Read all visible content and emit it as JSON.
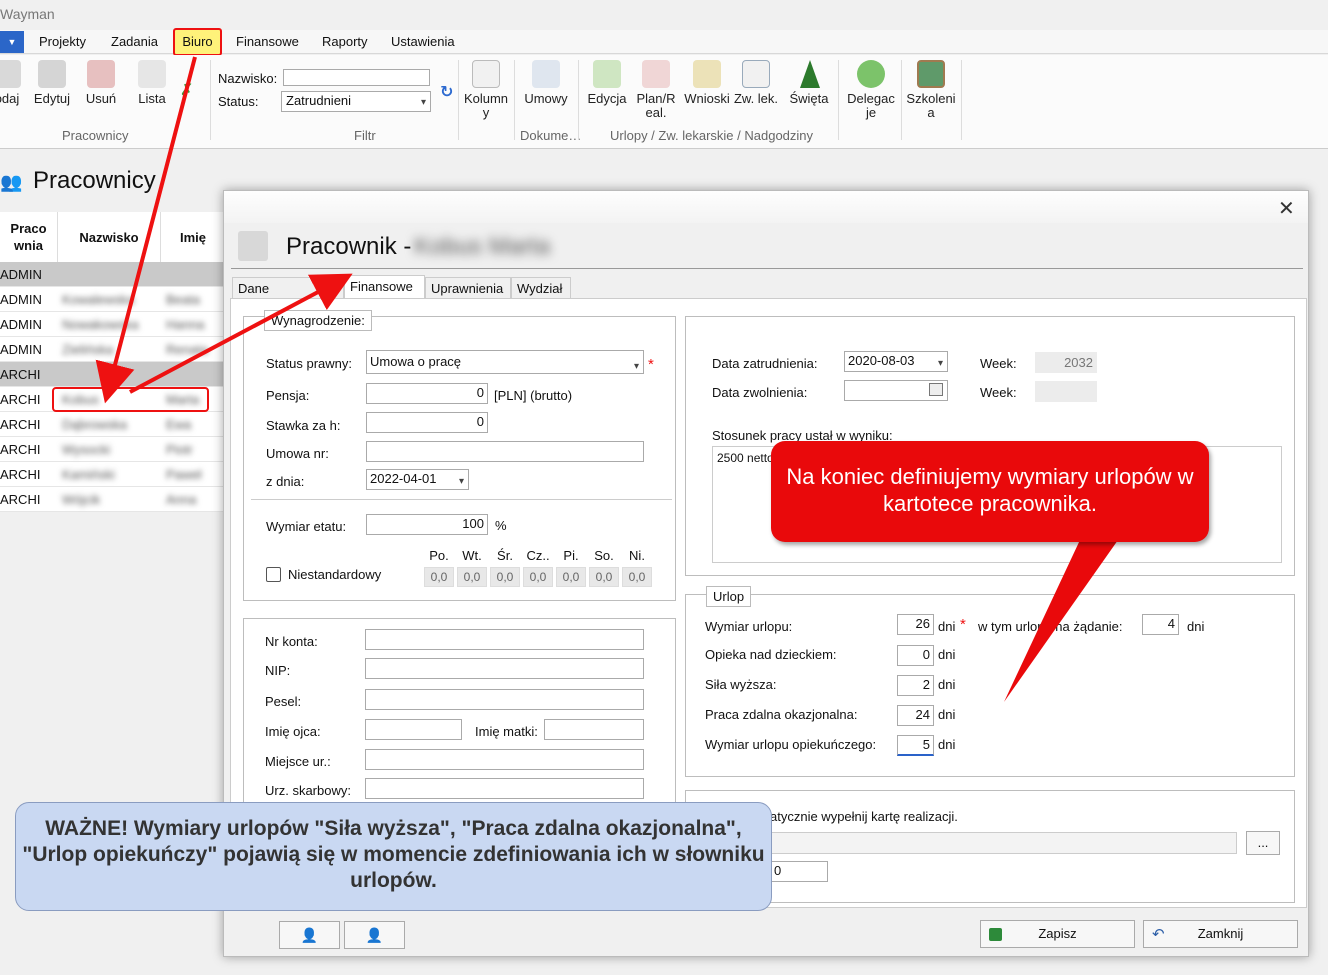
{
  "app": {
    "title": "Wayman"
  },
  "menu": {
    "dropdown_glyph": "▼",
    "items": [
      "Projekty",
      "Zadania",
      "Biuro",
      "Finansowe",
      "Raporty",
      "Ustawienia"
    ]
  },
  "ribbon": {
    "pracownicy_buttons": [
      "odaj",
      "Edytuj",
      "Usuń",
      "Lista"
    ],
    "pracownicy_label": "Pracownicy",
    "filtr": {
      "nazwisko_label": "Nazwisko:",
      "nazwisko_value": "",
      "status_label": "Status:",
      "status_value": "Zatrudnieni",
      "label": "Filtr"
    },
    "kolumny": [
      "Kolumn",
      "y"
    ],
    "umowy": "Umowy",
    "dokumenty_label": "Dokume…",
    "urlopy_buttons": [
      [
        "Edycja",
        ""
      ],
      [
        "Plan/R",
        "eal."
      ],
      [
        "Wnioski",
        ""
      ],
      [
        "Zw. lek.",
        ""
      ],
      [
        "Święta",
        ""
      ]
    ],
    "urlopy_label": "Urlopy / Zw. lekarskie / Nadgodziny",
    "delegacje": [
      "Delegac",
      "je"
    ],
    "szkolenia": [
      "Szkoleni",
      "a"
    ]
  },
  "list": {
    "title": "Pracownicy",
    "headers": [
      "Praco\nwnia",
      "Nazwisko",
      "Imię"
    ],
    "rows": [
      {
        "pracownia": "ADMIN",
        "nazwisko": "",
        "imie": "",
        "gray": true
      },
      {
        "pracownia": "ADMIN",
        "nazwisko": "Kowalewska",
        "imie": "Beata",
        "gray": false
      },
      {
        "pracownia": "ADMIN",
        "nazwisko": "Nowakowska",
        "imie": "Hanna",
        "gray": false
      },
      {
        "pracownia": "ADMIN",
        "nazwisko": "Zielińska",
        "imie": "Renata",
        "gray": false
      },
      {
        "pracownia": "ARCHI",
        "nazwisko": "",
        "imie": "",
        "gray": true
      },
      {
        "pracownia": "ARCHI",
        "nazwisko": "Kobus",
        "imie": "Marta",
        "gray": false
      },
      {
        "pracownia": "ARCHI",
        "nazwisko": "Dąbrowska",
        "imie": "Ewa",
        "gray": false
      },
      {
        "pracownia": "ARCHI",
        "nazwisko": "Wysocki",
        "imie": "Piotr",
        "gray": false
      },
      {
        "pracownia": "ARCHI",
        "nazwisko": "Kamiński",
        "imie": "Paweł",
        "gray": false
      },
      {
        "pracownia": "ARCHI",
        "nazwisko": "Wójcik",
        "imie": "Anna",
        "gray": false
      }
    ]
  },
  "dialog": {
    "title": "Pracownik -",
    "employee_name": "Kobus Marta",
    "close_glyph": "✕",
    "tabs": [
      "Dane pracownika",
      "Finansowe",
      "Uprawnienia",
      "Wydział"
    ],
    "wynagrodzenie": {
      "label": "Wynagrodzenie:",
      "status_prawny_label": "Status prawny:",
      "status_prawny_value": "Umowa o pracę",
      "pensja_label": "Pensja:",
      "pensja_value": "0",
      "pensja_unit": "[PLN] (brutto)",
      "stawka_label": "Stawka za h:",
      "stawka_value": "0",
      "umowa_nr_label": "Umowa nr:",
      "umowa_nr_value": "",
      "z_dnia_label": "z dnia:",
      "z_dnia_value": "2022-04-01",
      "wymiar_etatu_label": "Wymiar etatu:",
      "wymiar_etatu_value": "100",
      "wymiar_etatu_unit": "%",
      "days": [
        "Po.",
        "Wt.",
        "Śr.",
        "Cz..",
        "Pi.",
        "So.",
        "Ni."
      ],
      "day_values": [
        "0,0",
        "0,0",
        "0,0",
        "0,0",
        "0,0",
        "0,0",
        "0,0"
      ],
      "niestandardowy_label": "Niestandardowy"
    },
    "dane": {
      "nr_konta": "Nr konta:",
      "nip": "NIP:",
      "pesel": "Pesel:",
      "imie_ojca": "Imię ojca:",
      "imie_matki": "Imię matki:",
      "miejsce_ur": "Miejsce ur.:",
      "urz_skarbowy": "Urz. skarbowy:"
    },
    "zatrudnienie": {
      "data_zatrudnienia_label": "Data zatrudnienia:",
      "data_zatrudnienia_value": "2020-08-03",
      "week_label": "Week:",
      "week_value": "2032",
      "data_zwolnienia_label": "Data zwolnienia:",
      "week2_label": "Week:",
      "stosunek_label": "Stosunek pracy ustał w wyniku:",
      "stosunek_value": "2500 netto"
    },
    "urlop": {
      "label": "Urlop",
      "wymiar_label": "Wymiar urlopu:",
      "wymiar_value": "26",
      "zadanie_label": "w tym urlopu na żądanie:",
      "zadanie_value": "4",
      "opieka_label": "Opieka nad dzieckiem:",
      "opieka_value": "0",
      "sila_label": "Siła wyższa:",
      "sila_value": "2",
      "praca_zdalna_label": "Praca zdalna okazjonalna:",
      "praca_zdalna_value": "24",
      "opiekunczy_label": "Wymiar urlopu opiekuńczego:",
      "opiekunczy_value": "5",
      "unit": "dni"
    },
    "realizacja": {
      "label": "atycznie wypełnij kartę realizacji.",
      "browse": "...",
      "value": "0"
    },
    "buttons": {
      "save": "Zapisz",
      "close": "Zamknij"
    }
  },
  "callouts": {
    "red": "Na koniec definiujemy wymiary urlopów w kartotece pracownika.",
    "blue": "WAŻNE! Wymiary urlopów \"Siła wyższa\", \"Praca zdalna okazjonalna\", \"Urlop opiekuńczy\" pojawią się w momencie zdefiniowania ich w słowniku urlopów."
  },
  "colors": {
    "annotation_red": "#e9090b",
    "callout_blue": "#c9d8f2",
    "menu_highlight": "#fff27a"
  }
}
